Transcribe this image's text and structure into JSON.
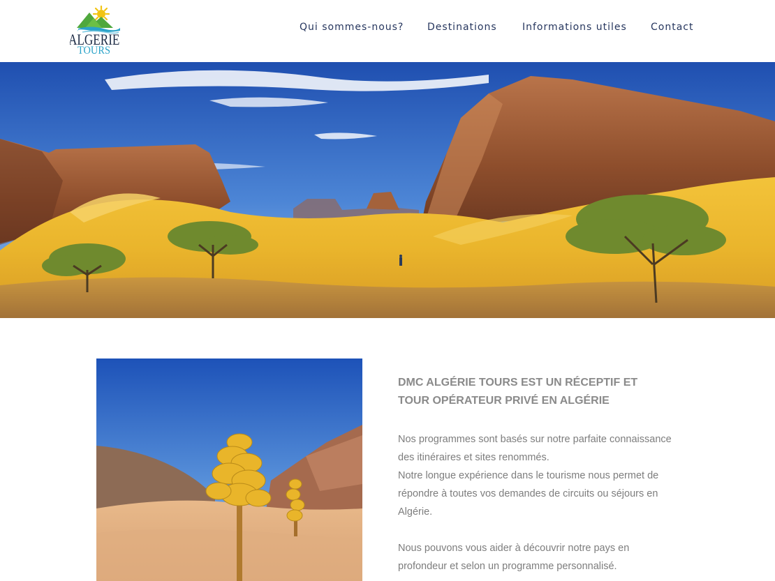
{
  "header": {
    "logo": {
      "line1": "ALGERIE",
      "line2": "TOURS",
      "icon": "sun-mountain-wave-logo"
    },
    "nav": [
      {
        "label": "Qui sommes-nous?"
      },
      {
        "label": "Destinations"
      },
      {
        "label": "Informations utiles"
      },
      {
        "label": "Contact"
      }
    ]
  },
  "hero": {
    "image": "sahara-desert-dunes-cliffs-acacia-trees"
  },
  "main": {
    "photo": "desert-yellow-flowering-plant",
    "headline": "DMC ALGÉRIE TOURS EST UN RÉCEPTIF ET TOUR OPÉRATEUR PRIVÉ EN ALGÉRIE",
    "paragraph1": "Nos programmes sont basés sur notre parfaite connaissance des itinéraires et sites renommés.",
    "paragraph2": "Notre longue expérience dans le tourisme nous permet de répondre à toutes vos demandes de circuits ou séjours en Algérie.",
    "paragraph3": "Nous pouvons vous aider à découvrir notre pays en profondeur et selon un programme personnalisé."
  },
  "colors": {
    "nav_text": "#26365e",
    "headline": "#8a8a8a",
    "body_text": "#7d7d7d",
    "logo_blue": "#2aa3c9",
    "logo_dark": "#1b2a44"
  }
}
